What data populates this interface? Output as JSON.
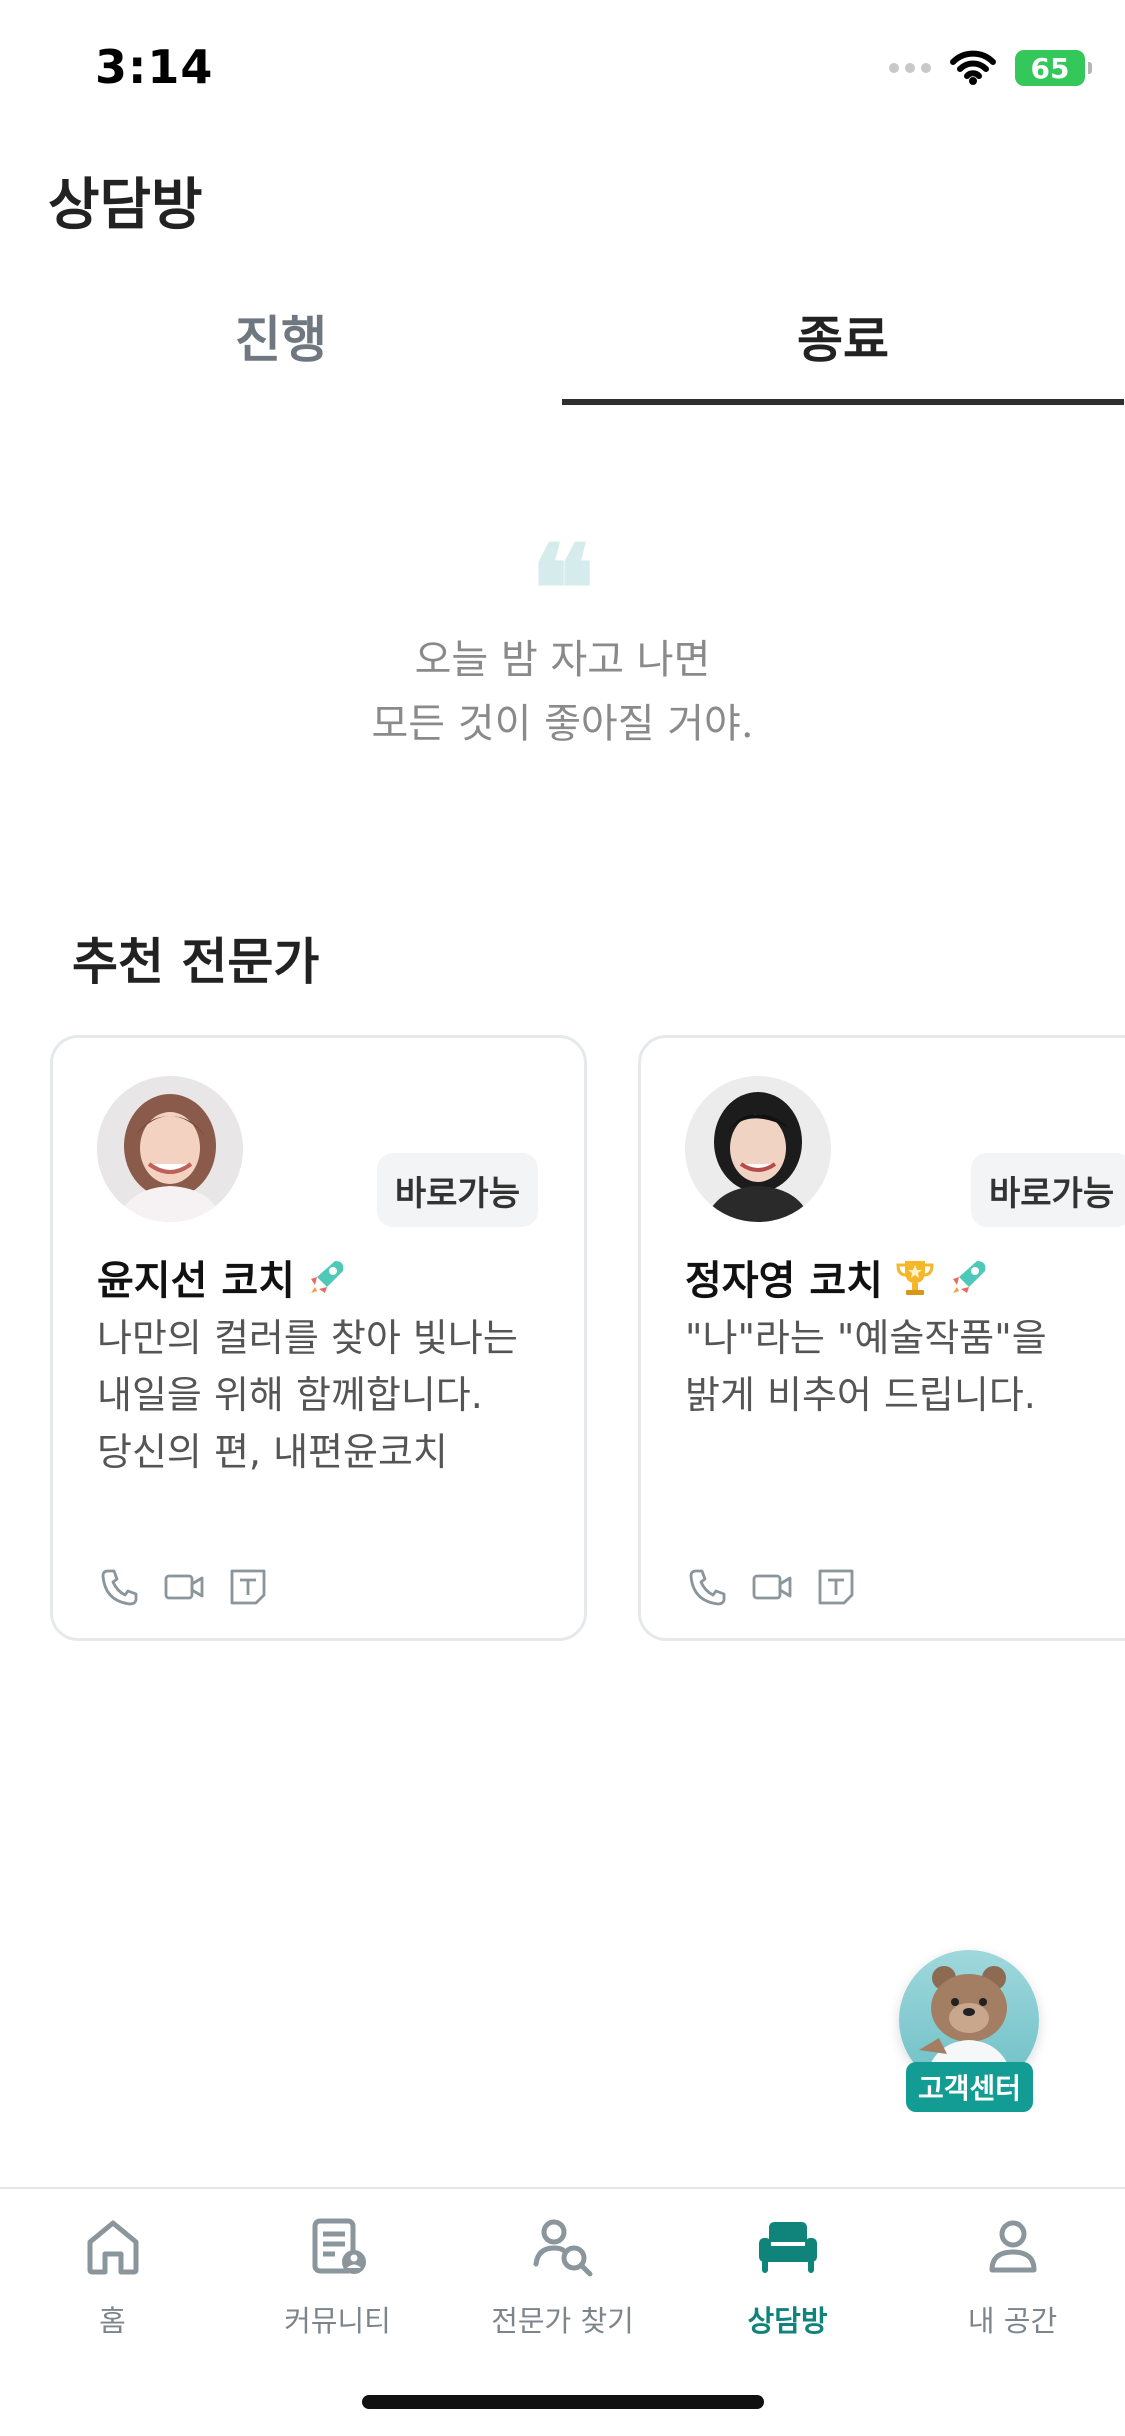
{
  "status_bar": {
    "time": "3:14",
    "battery": "65"
  },
  "header": {
    "title": "상담방"
  },
  "tabs": [
    {
      "label": "진행",
      "active": false
    },
    {
      "label": "종료",
      "active": true
    }
  ],
  "quote": {
    "line1": "오늘 밤 자고 나면",
    "line2": "모든 것이 좋아질 거야."
  },
  "recommended": {
    "title": "추천 전문가",
    "cards": [
      {
        "name": "윤지선 코치",
        "badge": "바로가능",
        "desc_lines": [
          "나만의 컬러를 찾아 빛나는",
          "내일을 위해 함께합니다.",
          "당신의 편, 내편윤코치"
        ],
        "icons": [
          "rocket-icon"
        ]
      },
      {
        "name": "정자영 코치",
        "badge": "바로가능",
        "desc_lines": [
          "\"나\"라는 \"예술작품\"을",
          "밝게 비추어 드립니다.",
          ""
        ],
        "icons": [
          "trophy-icon",
          "rocket-icon"
        ]
      }
    ]
  },
  "cs_button": {
    "label": "고객센터"
  },
  "bottom_nav": [
    {
      "label": "홈",
      "icon": "home-icon",
      "active": false
    },
    {
      "label": "커뮤니티",
      "icon": "community-icon",
      "active": false
    },
    {
      "label": "전문가 찾기",
      "icon": "find-expert-icon",
      "active": false
    },
    {
      "label": "상담방",
      "icon": "counseling-room-icon",
      "active": true
    },
    {
      "label": "내 공간",
      "icon": "profile-icon",
      "active": false
    }
  ],
  "colors": {
    "accent": "#10837b",
    "tab_indicator": "#2e2e2e",
    "quote_mark": "#d6ecec",
    "card_border": "#e6e9eb"
  }
}
